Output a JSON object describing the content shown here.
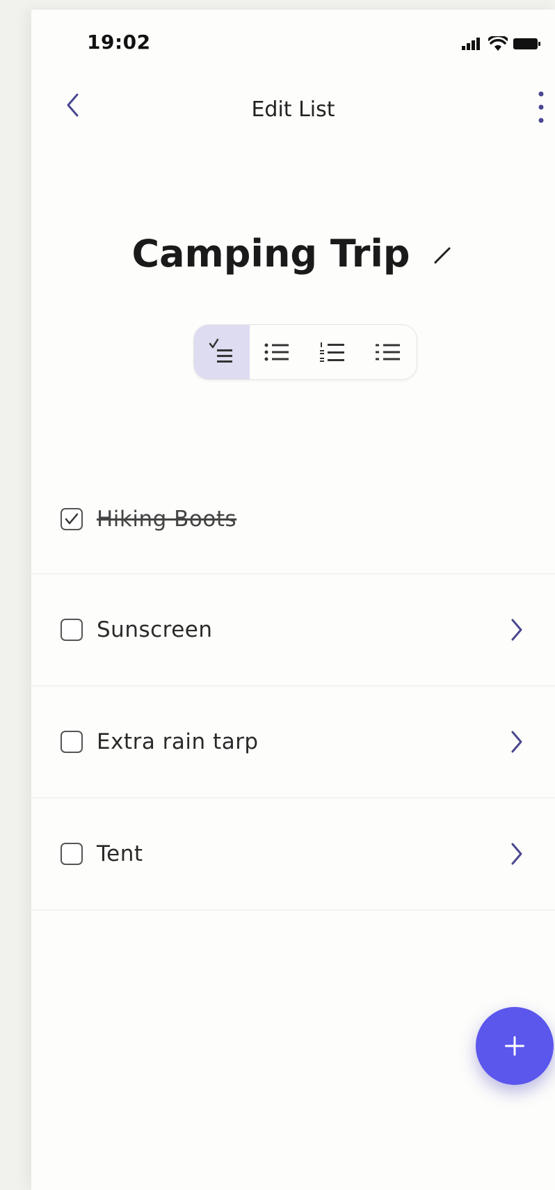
{
  "status_bar": {
    "time": "19:02",
    "icons": [
      "signal-icon",
      "wifi-icon",
      "battery-icon"
    ]
  },
  "nav": {
    "title": "Edit List",
    "back_icon": "chevron-left-icon",
    "more_icon": "more-vertical-icon"
  },
  "list": {
    "title": "Camping Trip",
    "edit_icon": "pencil-icon"
  },
  "view_modes": [
    {
      "name": "checklist",
      "icon": "checklist-icon",
      "active": true
    },
    {
      "name": "bulleted",
      "icon": "bulleted-list-icon",
      "active": false
    },
    {
      "name": "numbered",
      "icon": "numbered-list-icon",
      "active": false
    },
    {
      "name": "plain",
      "icon": "plain-list-icon",
      "active": false
    }
  ],
  "items": [
    {
      "label": "Hiking Boots",
      "checked": true,
      "has_chevron": false
    },
    {
      "label": "Sunscreen",
      "checked": false,
      "has_chevron": true
    },
    {
      "label": "Extra rain tarp",
      "checked": false,
      "has_chevron": true
    },
    {
      "label": "Tent",
      "checked": false,
      "has_chevron": true
    }
  ],
  "fab": {
    "icon": "plus-icon"
  },
  "colors": {
    "accent": "#5b56ec",
    "chevron": "#4a4790",
    "segment_active": "#dddcf0",
    "background": "#fdfdfb"
  }
}
